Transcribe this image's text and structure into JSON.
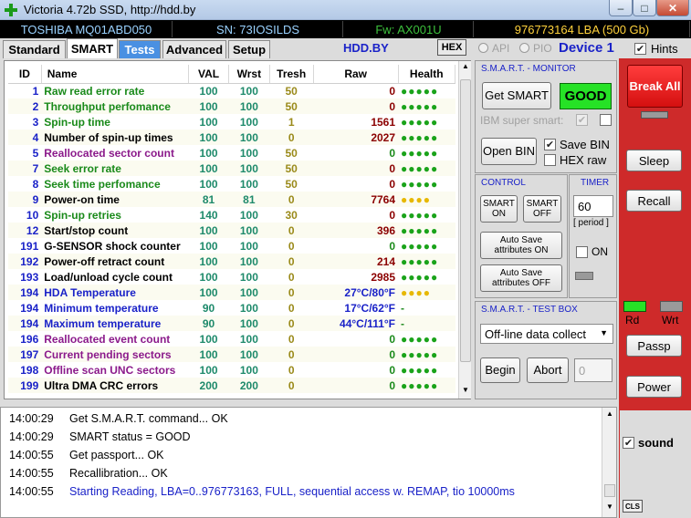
{
  "window": {
    "title": "Victoria 4.72b SSD, http://hdd.by",
    "controls": {
      "minimize": "–",
      "maximize": "□",
      "close": "✕"
    }
  },
  "info": {
    "model": "TOSHIBA MQ01ABD050",
    "serial": "SN: 73IOSILDS",
    "firmware": "Fw: AX001U",
    "lba": "976773164 LBA (500 Gb)"
  },
  "tabs": [
    {
      "label": "Standard"
    },
    {
      "label": "SMART"
    },
    {
      "label": "Tests"
    },
    {
      "label": "Advanced"
    },
    {
      "label": "Setup"
    }
  ],
  "toolbar": {
    "site": "HDD.BY",
    "hex_label": "HEX",
    "api_label": "API",
    "pio_label": "PIO",
    "device_label": "Device 1",
    "hints_label": "Hints"
  },
  "table": {
    "headers": [
      "ID",
      "Name",
      "VAL",
      "Wrst",
      "Tresh",
      "Raw",
      "Health"
    ],
    "rows": [
      {
        "id": "1",
        "name": "Raw read error rate",
        "val": "100",
        "wrst": "100",
        "tresh": "50",
        "raw": "0",
        "health": "●●●●●",
        "name_color": "#1a8a1a",
        "raw_color": "#8b0000",
        "health_color": "green"
      },
      {
        "id": "2",
        "name": "Throughput perfomance",
        "val": "100",
        "wrst": "100",
        "tresh": "50",
        "raw": "0",
        "health": "●●●●●",
        "name_color": "#1a8a1a",
        "raw_color": "#8b0000",
        "health_color": "green"
      },
      {
        "id": "3",
        "name": "Spin-up time",
        "val": "100",
        "wrst": "100",
        "tresh": "1",
        "raw": "1561",
        "health": "●●●●●",
        "name_color": "#1a8a1a",
        "raw_color": "#8b0000",
        "health_color": "green"
      },
      {
        "id": "4",
        "name": "Number of spin-up times",
        "val": "100",
        "wrst": "100",
        "tresh": "0",
        "raw": "2027",
        "health": "●●●●●",
        "name_color": "#000000",
        "raw_color": "#8b0000",
        "health_color": "green"
      },
      {
        "id": "5",
        "name": "Reallocated sector count",
        "val": "100",
        "wrst": "100",
        "tresh": "50",
        "raw": "0",
        "health": "●●●●●",
        "name_color": "#8b1a8b",
        "raw_color": "#1a8a1a",
        "health_color": "green"
      },
      {
        "id": "7",
        "name": "Seek error rate",
        "val": "100",
        "wrst": "100",
        "tresh": "50",
        "raw": "0",
        "health": "●●●●●",
        "name_color": "#1a8a1a",
        "raw_color": "#8b0000",
        "health_color": "green"
      },
      {
        "id": "8",
        "name": "Seek time perfomance",
        "val": "100",
        "wrst": "100",
        "tresh": "50",
        "raw": "0",
        "health": "●●●●●",
        "name_color": "#1a8a1a",
        "raw_color": "#8b0000",
        "health_color": "green"
      },
      {
        "id": "9",
        "name": "Power-on time",
        "val": "81",
        "wrst": "81",
        "tresh": "0",
        "raw": "7764",
        "health": "●●●●",
        "name_color": "#000000",
        "raw_color": "#8b0000",
        "health_color": "yellow"
      },
      {
        "id": "10",
        "name": "Spin-up retries",
        "val": "140",
        "wrst": "100",
        "tresh": "30",
        "raw": "0",
        "health": "●●●●●",
        "name_color": "#1a8a1a",
        "raw_color": "#8b0000",
        "health_color": "green"
      },
      {
        "id": "12",
        "name": "Start/stop count",
        "val": "100",
        "wrst": "100",
        "tresh": "0",
        "raw": "396",
        "health": "●●●●●",
        "name_color": "#000000",
        "raw_color": "#8b0000",
        "health_color": "green"
      },
      {
        "id": "191",
        "name": "G-SENSOR shock counter",
        "val": "100",
        "wrst": "100",
        "tresh": "0",
        "raw": "0",
        "health": "●●●●●",
        "name_color": "#000000",
        "raw_color": "#1a8a1a",
        "health_color": "green"
      },
      {
        "id": "192",
        "name": "Power-off retract count",
        "val": "100",
        "wrst": "100",
        "tresh": "0",
        "raw": "214",
        "health": "●●●●●",
        "name_color": "#000000",
        "raw_color": "#8b0000",
        "health_color": "green"
      },
      {
        "id": "193",
        "name": "Load/unload cycle count",
        "val": "100",
        "wrst": "100",
        "tresh": "0",
        "raw": "2985",
        "health": "●●●●●",
        "name_color": "#000000",
        "raw_color": "#8b0000",
        "health_color": "green"
      },
      {
        "id": "194",
        "name": "HDA Temperature",
        "val": "100",
        "wrst": "100",
        "tresh": "0",
        "raw": "27°C/80°F",
        "health": "●●●●",
        "name_color": "#1a22c8",
        "raw_color": "#1a22c8",
        "health_color": "yellow"
      },
      {
        "id": "194",
        "name": "Minimum temperature",
        "val": "90",
        "wrst": "100",
        "tresh": "0",
        "raw": "17°C/62°F",
        "health": "-",
        "name_color": "#1a22c8",
        "raw_color": "#1a22c8",
        "health_color": "dash"
      },
      {
        "id": "194",
        "name": "Maximum temperature",
        "val": "90",
        "wrst": "100",
        "tresh": "0",
        "raw": "44°C/111°F",
        "health": "-",
        "name_color": "#1a22c8",
        "raw_color": "#1a22c8",
        "health_color": "dash"
      },
      {
        "id": "196",
        "name": "Reallocated event count",
        "val": "100",
        "wrst": "100",
        "tresh": "0",
        "raw": "0",
        "health": "●●●●●",
        "name_color": "#8b1a8b",
        "raw_color": "#1a8a1a",
        "health_color": "green"
      },
      {
        "id": "197",
        "name": "Current pending sectors",
        "val": "100",
        "wrst": "100",
        "tresh": "0",
        "raw": "0",
        "health": "●●●●●",
        "name_color": "#8b1a8b",
        "raw_color": "#1a8a1a",
        "health_color": "green"
      },
      {
        "id": "198",
        "name": "Offline scan UNC sectors",
        "val": "100",
        "wrst": "100",
        "tresh": "0",
        "raw": "0",
        "health": "●●●●●",
        "name_color": "#8b1a8b",
        "raw_color": "#1a8a1a",
        "health_color": "green"
      },
      {
        "id": "199",
        "name": "Ultra DMA CRC errors",
        "val": "200",
        "wrst": "200",
        "tresh": "0",
        "raw": "0",
        "health": "●●●●●",
        "name_color": "#000000",
        "raw_color": "#1a8a1a",
        "health_color": "green"
      }
    ]
  },
  "monitor": {
    "title": "S.M.A.R.T. - MONITOR",
    "get_smart": "Get SMART",
    "status": "GOOD",
    "ibm_label": "IBM super smart:",
    "open_bin": "Open BIN",
    "save_bin": "Save BIN",
    "hex_raw": "HEX raw"
  },
  "control": {
    "title": "CONTROL",
    "smart_on": "SMART ON",
    "smart_off": "SMART OFF",
    "autosave_on": "Auto Save attributes ON",
    "autosave_off": "Auto Save attributes OFF"
  },
  "timer": {
    "title": "TIMER",
    "period_value": "60",
    "period_label": "[ period ]",
    "on_label": "ON"
  },
  "testbox": {
    "title": "S.M.A.R.T. - TEST BOX",
    "selected": "Off-line data collect",
    "begin": "Begin",
    "abort": "Abort",
    "count": "0"
  },
  "right": {
    "break_all": "Break All",
    "sleep": "Sleep",
    "recall": "Recall",
    "rd": "Rd",
    "wrt": "Wrt",
    "passp": "Passp",
    "power": "Power",
    "sound": "sound",
    "cls": "CLS"
  },
  "log": [
    {
      "time": "14:00:29",
      "text": "Get S.M.A.R.T. command... OK",
      "color": "#000000"
    },
    {
      "time": "14:00:29",
      "text": "SMART status = GOOD",
      "color": "#000000"
    },
    {
      "time": "14:00:55",
      "text": "Get passport... OK",
      "color": "#000000"
    },
    {
      "time": "14:00:55",
      "text": "Recallibration... OK",
      "color": "#000000"
    },
    {
      "time": "14:00:55",
      "text": "Starting Reading, LBA=0..976773163, FULL, sequential access w. REMAP, tio 10000ms",
      "color": "#1a22c8"
    }
  ]
}
